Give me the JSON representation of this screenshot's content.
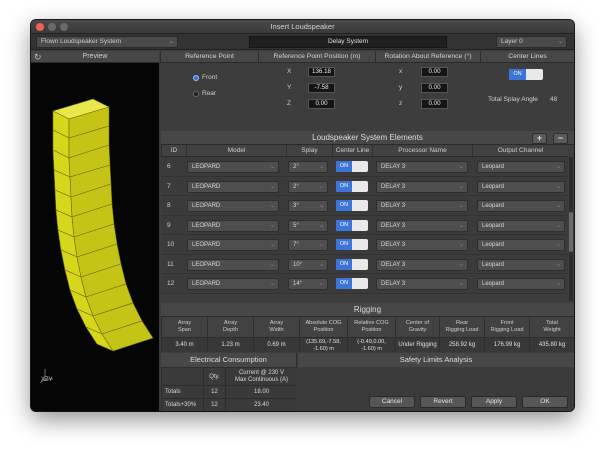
{
  "window": {
    "title": "Insert Loudspeaker"
  },
  "topbar": {
    "system_type": "Flown Loudspeaker System",
    "system_name": "Delay System",
    "layer": "Layer 0"
  },
  "preview": {
    "label": "Preview",
    "axis_label": "XZY"
  },
  "reference_point": {
    "header": "Reference Point",
    "options": [
      "Front",
      "Rear"
    ],
    "selected": "Front"
  },
  "reference_position": {
    "header": "Reference Point Position (m)",
    "labels": [
      "X",
      "Y",
      "Z"
    ],
    "values": [
      "136.18",
      "-7.58",
      "0.00"
    ]
  },
  "rotation": {
    "header": "Rotation About Reference (°)",
    "labels": [
      "x",
      "y",
      "z"
    ],
    "values": [
      "0.00",
      "0.00",
      "0.00"
    ]
  },
  "center_lines": {
    "header": "Center Lines",
    "toggle_label": "ON",
    "total_splay_label": "Total Splay Angle",
    "total_splay_value": "48"
  },
  "elements": {
    "title": "Loudspeaker System Elements",
    "add_label": "+",
    "remove_label": "−",
    "columns": [
      "ID",
      "Model",
      "Splay",
      "Center Line",
      "Processor Name",
      "Output Channel"
    ],
    "rows": [
      {
        "id": "6",
        "model": "LEOPARD",
        "splay": "2°",
        "center": "ON",
        "processor": "DELAY 3",
        "output": "Leopard"
      },
      {
        "id": "7",
        "model": "LEOPARD",
        "splay": "2°",
        "center": "ON",
        "processor": "DELAY 3",
        "output": "Leopard"
      },
      {
        "id": "8",
        "model": "LEOPARD",
        "splay": "3°",
        "center": "ON",
        "processor": "DELAY 3",
        "output": "Leopard"
      },
      {
        "id": "9",
        "model": "LEOPARD",
        "splay": "5°",
        "center": "ON",
        "processor": "DELAY 3",
        "output": "Leopard"
      },
      {
        "id": "10",
        "model": "LEOPARD",
        "splay": "7°",
        "center": "ON",
        "processor": "DELAY 3",
        "output": "Leopard"
      },
      {
        "id": "11",
        "model": "LEOPARD",
        "splay": "10°",
        "center": "ON",
        "processor": "DELAY 3",
        "output": "Leopard"
      },
      {
        "id": "12",
        "model": "LEOPARD",
        "splay": "14°",
        "center": "ON",
        "processor": "DELAY 3",
        "output": "Leopard"
      }
    ]
  },
  "rigging": {
    "title": "Rigging",
    "headers": [
      [
        "Array",
        "Span"
      ],
      [
        "Array",
        "Depth"
      ],
      [
        "Array",
        "Width"
      ],
      [
        "Absolute COG",
        "Position"
      ],
      [
        "Relative COG",
        "Position"
      ],
      [
        "Center of",
        "Gravity"
      ],
      [
        "Rear",
        "Rigging Load"
      ],
      [
        "Front",
        "Rigging Load"
      ],
      [
        "Total",
        "Weight"
      ]
    ],
    "values": [
      [
        "3.40 m"
      ],
      [
        "1.23 m"
      ],
      [
        "0.69 m"
      ],
      [
        "(135.69,-7.58,",
        "-1.60) m"
      ],
      [
        "(-0.49,0.00,",
        "-1.60) m"
      ],
      [
        "Under Rigging"
      ],
      [
        "258.92 kg"
      ],
      [
        "176.99 kg"
      ],
      [
        "435.80 kg"
      ]
    ]
  },
  "electrical": {
    "title": "Electrical Consumption",
    "qty_header": "Qty.",
    "current_header_1": "Current @ 230 V",
    "current_header_2": "Max Continuous (A)",
    "rows": [
      {
        "label": "Totals",
        "qty": "12",
        "current": "18.00"
      },
      {
        "label": "Totals+30%",
        "qty": "12",
        "current": "23.40"
      }
    ]
  },
  "safety": {
    "title": "Safety Limits Analysis"
  },
  "buttons": {
    "cancel": "Cancel",
    "revert": "Revert",
    "apply": "Apply",
    "ok": "OK"
  },
  "colors": {
    "toggle_on": "#3d74d8",
    "speaker_yellow": "#d6d61a",
    "close_red": "#f35f57"
  }
}
